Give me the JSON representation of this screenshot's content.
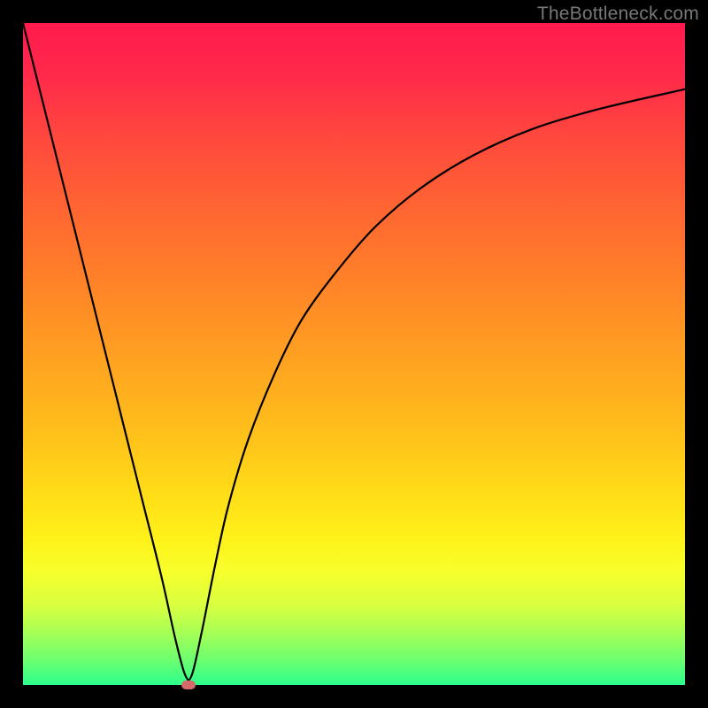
{
  "watermark": "TheBottleneck.com",
  "chart_data": {
    "type": "line",
    "title": "",
    "xlabel": "",
    "ylabel": "",
    "xlim": [
      0,
      100
    ],
    "ylim": [
      0,
      100
    ],
    "grid": false,
    "legend": false,
    "note": "x/y are approximate percentages of the plot area (0,0 = bottom-left). The curve is a V-shape: a steep descending left branch reaching ~0 at x≈25, then an asymptotic rising right branch approaching ~90.",
    "series": [
      {
        "name": "curve",
        "color": "#000000",
        "x": [
          0,
          3,
          6,
          9,
          12,
          15,
          18,
          21,
          23,
          24.5,
          25.5,
          27,
          29,
          31,
          34,
          38,
          42,
          47,
          53,
          60,
          68,
          77,
          87,
          100
        ],
        "values": [
          100,
          88,
          76,
          64,
          52,
          40,
          28,
          16,
          7,
          1.5,
          1.5,
          8,
          18,
          27,
          37,
          47,
          55,
          62,
          69,
          75,
          80,
          84,
          87,
          90
        ]
      }
    ],
    "vertex_marker": {
      "x": 25,
      "y": 0,
      "color": "#d66a6a"
    }
  }
}
